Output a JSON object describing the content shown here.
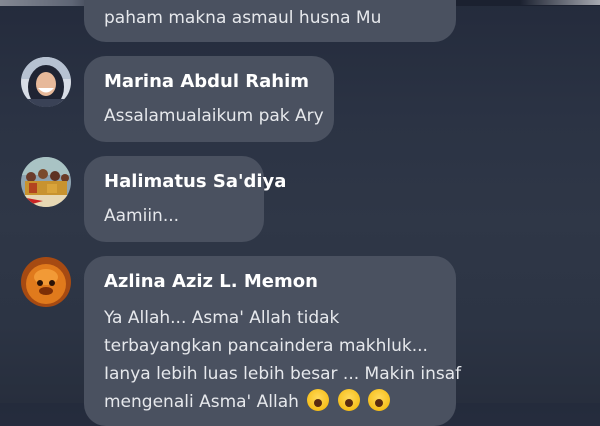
{
  "chat": {
    "messages": [
      {
        "author": "",
        "lines": [
          "paham makna asmaul husna Mu"
        ],
        "avatar_icon": ""
      },
      {
        "author": "Marina Abdul Rahim",
        "lines": [
          "Assalamualaikum pak Ary"
        ],
        "avatar_icon": "user-photo-hijab"
      },
      {
        "author": "Halimatus Sa'diya",
        "lines": [
          "Aamiin..."
        ],
        "avatar_icon": "user-photo-group"
      },
      {
        "author": "Azlina Aziz L. Memon",
        "lines": [
          "Ya Allah... Asma' Allah tidak",
          "terbayangkan pancaindera makhluk...",
          "Ianya lebih luas lebih besar ... Makin insaf",
          "mengenali Asma' Allah"
        ],
        "emojis": [
          "crying-face-emoji",
          "crying-face-emoji",
          "crying-face-emoji"
        ],
        "avatar_icon": "user-photo-orange"
      }
    ]
  },
  "colors": {
    "background": "#2c3444",
    "bubble": "#4a5160",
    "author_text": "#ffffff",
    "message_text": "#e6e8ec"
  }
}
